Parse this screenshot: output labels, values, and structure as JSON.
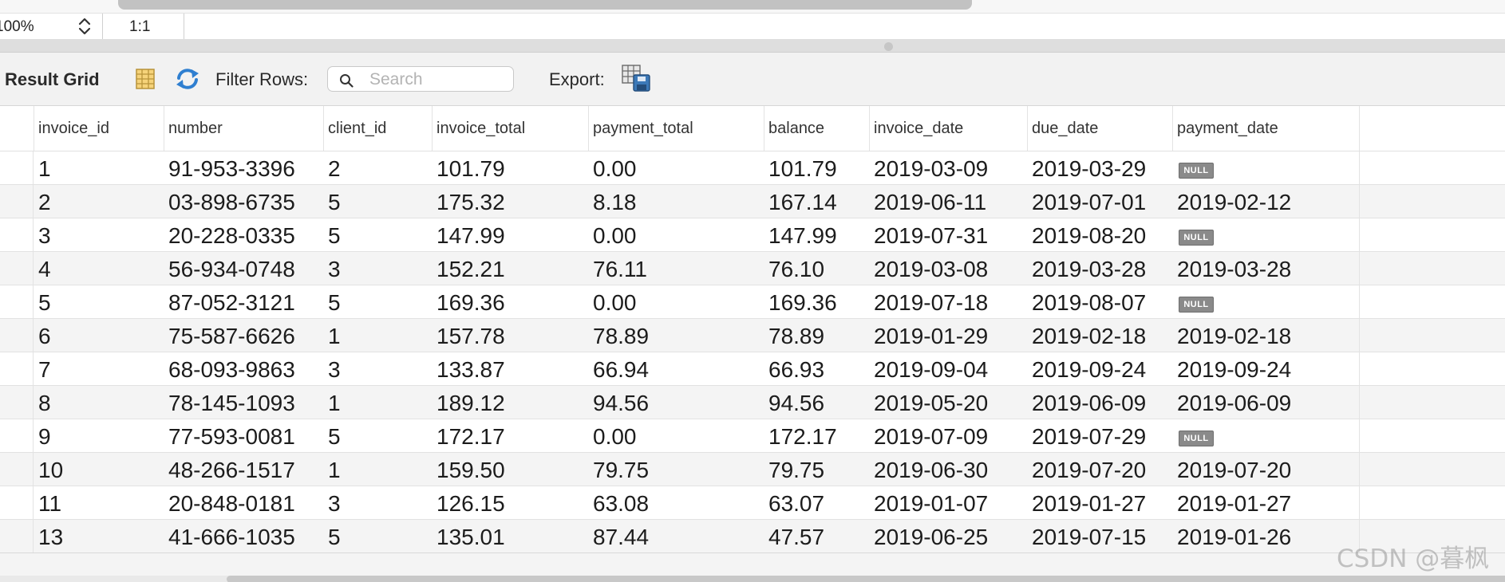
{
  "zoom": {
    "value": "100%",
    "ratio": "1:1"
  },
  "toolbar": {
    "title": "Result Grid",
    "filter_label": "Filter Rows:",
    "search_placeholder": "Search",
    "search_value": "",
    "export_label": "Export:"
  },
  "columns": [
    "invoice_id",
    "number",
    "client_id",
    "invoice_total",
    "payment_total",
    "balance",
    "invoice_date",
    "due_date",
    "payment_date"
  ],
  "null_label": "NULL",
  "rows": [
    [
      "1",
      "91-953-3396",
      "2",
      "101.79",
      "0.00",
      "101.79",
      "2019-03-09",
      "2019-03-29",
      null
    ],
    [
      "2",
      "03-898-6735",
      "5",
      "175.32",
      "8.18",
      "167.14",
      "2019-06-11",
      "2019-07-01",
      "2019-02-12"
    ],
    [
      "3",
      "20-228-0335",
      "5",
      "147.99",
      "0.00",
      "147.99",
      "2019-07-31",
      "2019-08-20",
      null
    ],
    [
      "4",
      "56-934-0748",
      "3",
      "152.21",
      "76.11",
      "76.10",
      "2019-03-08",
      "2019-03-28",
      "2019-03-28"
    ],
    [
      "5",
      "87-052-3121",
      "5",
      "169.36",
      "0.00",
      "169.36",
      "2019-07-18",
      "2019-08-07",
      null
    ],
    [
      "6",
      "75-587-6626",
      "1",
      "157.78",
      "78.89",
      "78.89",
      "2019-01-29",
      "2019-02-18",
      "2019-02-18"
    ],
    [
      "7",
      "68-093-9863",
      "3",
      "133.87",
      "66.94",
      "66.93",
      "2019-09-04",
      "2019-09-24",
      "2019-09-24"
    ],
    [
      "8",
      "78-145-1093",
      "1",
      "189.12",
      "94.56",
      "94.56",
      "2019-05-20",
      "2019-06-09",
      "2019-06-09"
    ],
    [
      "9",
      "77-593-0081",
      "5",
      "172.17",
      "0.00",
      "172.17",
      "2019-07-09",
      "2019-07-29",
      null
    ],
    [
      "10",
      "48-266-1517",
      "1",
      "159.50",
      "79.75",
      "79.75",
      "2019-06-30",
      "2019-07-20",
      "2019-07-20"
    ],
    [
      "11",
      "20-848-0181",
      "3",
      "126.15",
      "63.08",
      "63.07",
      "2019-01-07",
      "2019-01-27",
      "2019-01-27"
    ],
    [
      "13",
      "41-666-1035",
      "5",
      "135.01",
      "87.44",
      "47.57",
      "2019-06-25",
      "2019-07-15",
      "2019-01-26"
    ]
  ],
  "watermark": "CSDN @暮枫",
  "icons": {
    "zoom_stepper": "up-down-chevron-icon",
    "grid": "grid-icon",
    "refresh": "refresh-icon",
    "search": "search-icon",
    "export": "export-icon"
  },
  "colors": {
    "null_badge": "#8a8a8a",
    "row_alt": "#f4f4f4",
    "refresh_blue": "#2f7fd0"
  }
}
